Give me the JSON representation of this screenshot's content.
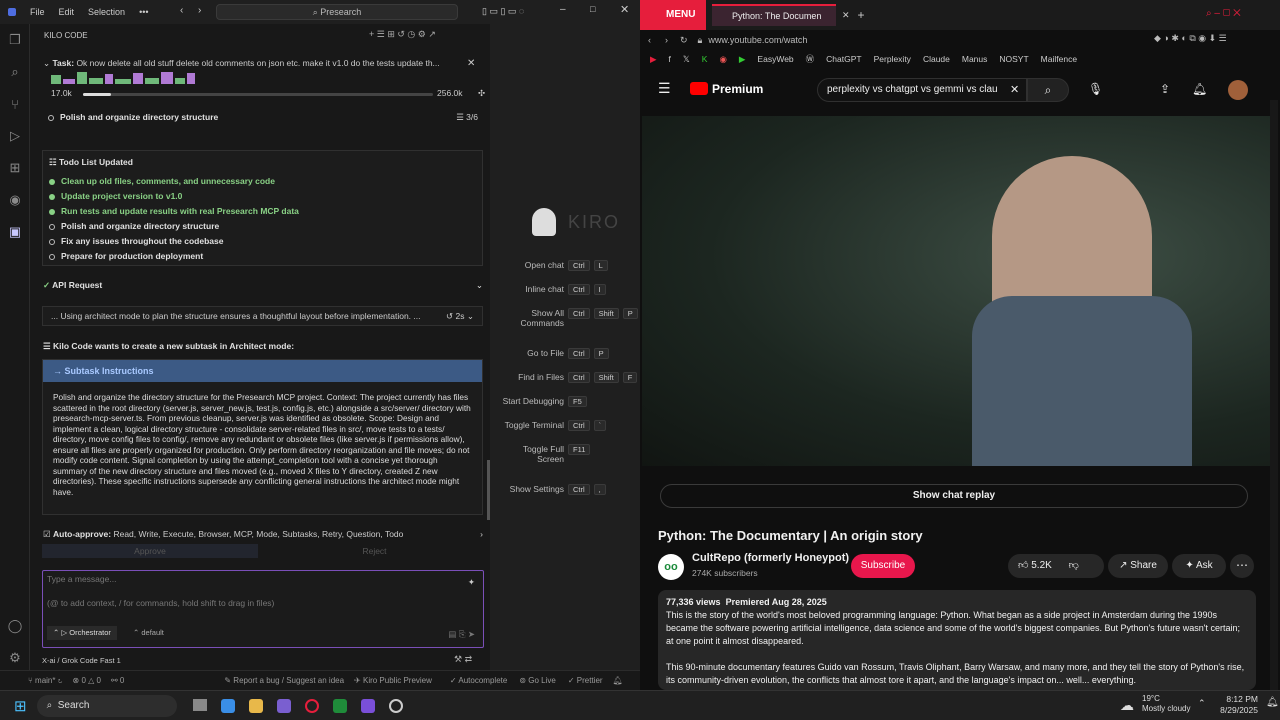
{
  "ide": {
    "menu": [
      "File",
      "Edit",
      "Selection"
    ],
    "more": "•••",
    "search": "Presearch",
    "panel_title": "KILO CODE",
    "task": {
      "label": "Task:",
      "text": "Ok now delete all old stuff delete old comments on json etc. make it v1.0 do the tests update th...",
      "tokens_left": "17.0k",
      "tokens_right": "256.0k",
      "progress": 0.08
    },
    "current_todo": {
      "text": "Polish and organize directory structure",
      "count": "3/6"
    },
    "todo_title": "Todo List Updated",
    "todos": [
      {
        "text": "Clean up old files, comments, and unnecessary code",
        "done": true
      },
      {
        "text": "Update project version to v1.0",
        "done": true
      },
      {
        "text": "Run tests and update results with real Presearch MCP data",
        "done": true
      },
      {
        "text": "Polish and organize directory structure",
        "done": false
      },
      {
        "text": "Fix any issues throughout the codebase",
        "done": false
      },
      {
        "text": "Prepare for production deployment",
        "done": false
      }
    ],
    "api": {
      "label": "API Request",
      "thinking": "... Using architect mode to plan the structure ensures a thoughtful layout before implementation. ...",
      "time": "2s"
    },
    "subtask_notice": "Kilo Code wants to create a new subtask in Architect mode:",
    "subtask_header": "Subtask Instructions",
    "subtask_body": "Polish and organize the directory structure for the Presearch MCP project. Context: The project currently has files scattered in the root directory (server.js, server_new.js, test.js, config.js, etc.) alongside a src/server/ directory with presearch-mcp-server.ts. From previous cleanup, server.js was identified as obsolete. Scope: Design and implement a clean, logical directory structure - consolidate server-related files in src/, move tests to a tests/ directory, move config files to config/, remove any redundant or obsolete files (like server.js if permissions allow), ensure all files are properly organized for production. Only perform directory reorganization and file moves; do not modify code content. Signal completion by using the attempt_completion tool with a concise yet thorough summary of the new directory structure and files moved (e.g., moved X files to Y directory, created Z new directories). These specific instructions supersede any conflicting general instructions the architect mode might have.",
    "auto_approve": {
      "label": "Auto-approve:",
      "items": "Read, Write, Execute, Browser, MCP, Mode, Subtasks, Retry, Question, Todo"
    },
    "approve": "Approve",
    "reject": "Reject",
    "input": {
      "placeholder": "Type a message...",
      "hint": "(@ to add context, / for commands, hold shift to drag in files)",
      "mode": "Orchestrator",
      "profile": "default"
    },
    "model": "X-ai / Grok Code Fast 1",
    "kiro": {
      "logo": "KIRO",
      "shortcuts": [
        {
          "label": "Open chat",
          "keys": [
            "Ctrl",
            "L"
          ]
        },
        {
          "label": "Inline chat",
          "keys": [
            "Ctrl",
            "I"
          ]
        },
        {
          "label": "Show All Commands",
          "keys": [
            "Ctrl",
            "Shift",
            "P"
          ]
        },
        {
          "label": "Go to File",
          "keys": [
            "Ctrl",
            "P"
          ]
        },
        {
          "label": "Find in Files",
          "keys": [
            "Ctrl",
            "Shift",
            "F"
          ]
        },
        {
          "label": "Start Debugging",
          "keys": [
            "F5"
          ]
        },
        {
          "label": "Toggle Terminal",
          "keys": [
            "Ctrl",
            "`"
          ]
        },
        {
          "label": "Toggle Full Screen",
          "keys": [
            "F11"
          ]
        },
        {
          "label": "Show Settings",
          "keys": [
            "Ctrl",
            ","
          ]
        }
      ]
    },
    "status": {
      "branch": "main*",
      "errors": "0",
      "warnings": "0",
      "ports": "0",
      "bug": "Report a bug / Suggest an idea",
      "kiro": "Kiro Public Preview",
      "autocomplete": "Autocomplete",
      "golive": "Go Live",
      "prettier": "Prettier"
    }
  },
  "browser": {
    "menu": "MENU",
    "tab": "Python: The Documen",
    "url": "www.youtube.com/watch",
    "bookmarks": [
      "EasyWeb",
      "ChatGPT",
      "Perplexity",
      "Claude",
      "Manus",
      "NOSYT",
      "Mailfence"
    ],
    "yt_logo": "Premium",
    "query": "perplexity vs chatgpt vs gemmi vs clau",
    "chat_replay": "Show chat replay",
    "title": "Python: The Documentary | An origin story",
    "channel": "CultRepo (formerly Honeypot)",
    "subs": "274K subscribers",
    "subscribe": "Subscribe",
    "likes": "5.2K",
    "share": "Share",
    "ask": "Ask",
    "views": "77,336 views",
    "premiered": "Premiered Aug 28, 2025",
    "desc1": "This is the story of the world's most beloved programming language: Python. What began as a side project in Amsterdam during the 1990s became the software powering artificial intelligence, data science and some of the world's biggest companies. But Python's future wasn't certain; at one point it almost disappeared.",
    "desc2": "This 90-minute documentary features Guido van Rossum, Travis Oliphant, Barry Warsaw, and many more, and they tell the story of Python's rise, its community-driven evolution, the conflicts that almost tore it apart, and the language's impact on... well... everything."
  },
  "taskbar": {
    "search": "Search",
    "temp": "19°C",
    "weather": "Mostly cloudy",
    "time": "8:12 PM",
    "date": "8/29/2025"
  }
}
